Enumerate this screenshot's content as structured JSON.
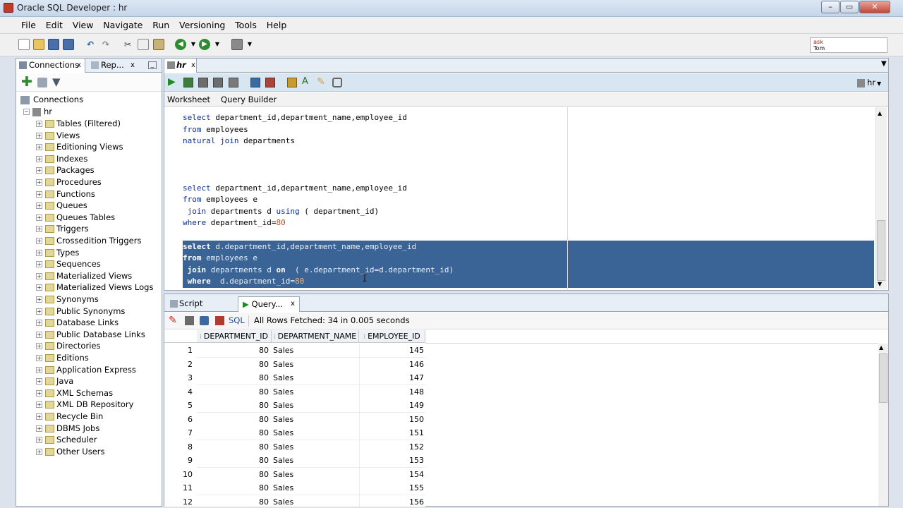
{
  "window": {
    "title": "Oracle SQL Developer : hr"
  },
  "menu": [
    "File",
    "Edit",
    "View",
    "Navigate",
    "Run",
    "Versioning",
    "Tools",
    "Help"
  ],
  "asktom": {
    "line1": "ask",
    "line2": "Tom"
  },
  "left_panel": {
    "tabs": [
      "Connections",
      "Rep..."
    ],
    "root": "Connections",
    "connection": "hr",
    "items": [
      "Tables (Filtered)",
      "Views",
      "Editioning Views",
      "Indexes",
      "Packages",
      "Procedures",
      "Functions",
      "Queues",
      "Queues Tables",
      "Triggers",
      "Crossedition Triggers",
      "Types",
      "Sequences",
      "Materialized Views",
      "Materialized Views Logs",
      "Synonyms",
      "Public Synonyms",
      "Database Links",
      "Public Database Links",
      "Directories",
      "Editions",
      "Application Express",
      "Java",
      "XML Schemas",
      "XML DB Repository",
      "Recycle Bin",
      "DBMS Jobs",
      "Scheduler",
      "Other Users"
    ]
  },
  "editor": {
    "tab": "hr",
    "connection_selector": "hr",
    "subtabs": [
      "Worksheet",
      "Query Builder"
    ],
    "lines": [
      [
        {
          "t": "select",
          "k": "kw"
        },
        {
          "t": " department_id,department_name,employee_id",
          "k": ""
        }
      ],
      [
        {
          "t": "from",
          "k": "kw"
        },
        {
          "t": " employees",
          "k": ""
        }
      ],
      [
        {
          "t": "natural",
          "k": "kw"
        },
        {
          "t": " ",
          "k": ""
        },
        {
          "t": "join",
          "k": "kw"
        },
        {
          "t": " departments",
          "k": ""
        }
      ],
      [],
      [],
      [],
      [
        {
          "t": "select",
          "k": "kw"
        },
        {
          "t": " department_id,department_name,employee_id",
          "k": ""
        }
      ],
      [
        {
          "t": "from",
          "k": "kw"
        },
        {
          "t": " employees e",
          "k": ""
        }
      ],
      [
        {
          "t": " join",
          "k": "kw"
        },
        {
          "t": " departments d ",
          "k": ""
        },
        {
          "t": "using",
          "k": "kw"
        },
        {
          "t": " ( department_id)",
          "k": ""
        }
      ],
      [
        {
          "t": "where",
          "k": "kw"
        },
        {
          "t": " department_id=",
          "k": ""
        },
        {
          "t": "80",
          "k": "num"
        }
      ],
      [],
      [
        {
          "t": "select",
          "k": "kw"
        },
        {
          "t": " d.department_id,department_name,employee_id",
          "k": ""
        }
      ],
      [
        {
          "t": "from",
          "k": "kw"
        },
        {
          "t": " employees e",
          "k": ""
        }
      ],
      [
        {
          "t": " join",
          "k": "kw"
        },
        {
          "t": " departments d ",
          "k": ""
        },
        {
          "t": "on",
          "k": "kw"
        },
        {
          "t": "  ( e.department_id=d.department_id)",
          "k": ""
        }
      ],
      [
        {
          "t": " where",
          "k": "kw"
        },
        {
          "t": "  d.department_id=",
          "k": ""
        },
        {
          "t": "80",
          "k": "num"
        }
      ]
    ],
    "selected_lines": [
      11,
      12,
      13,
      14
    ]
  },
  "results": {
    "tabs": [
      "Script Output",
      "Query..."
    ],
    "sql_label": "SQL",
    "status": "All Rows Fetched: 34 in 0.005 seconds",
    "columns": [
      "DEPARTMENT_ID",
      "DEPARTMENT_NAME",
      "EMPLOYEE_ID"
    ],
    "rows": [
      [
        "1",
        "80",
        "Sales",
        "145"
      ],
      [
        "2",
        "80",
        "Sales",
        "146"
      ],
      [
        "3",
        "80",
        "Sales",
        "147"
      ],
      [
        "4",
        "80",
        "Sales",
        "148"
      ],
      [
        "5",
        "80",
        "Sales",
        "149"
      ],
      [
        "6",
        "80",
        "Sales",
        "150"
      ],
      [
        "7",
        "80",
        "Sales",
        "151"
      ],
      [
        "8",
        "80",
        "Sales",
        "152"
      ],
      [
        "9",
        "80",
        "Sales",
        "153"
      ],
      [
        "10",
        "80",
        "Sales",
        "154"
      ],
      [
        "11",
        "80",
        "Sales",
        "155"
      ],
      [
        "12",
        "80",
        "Sales",
        "156"
      ]
    ]
  }
}
